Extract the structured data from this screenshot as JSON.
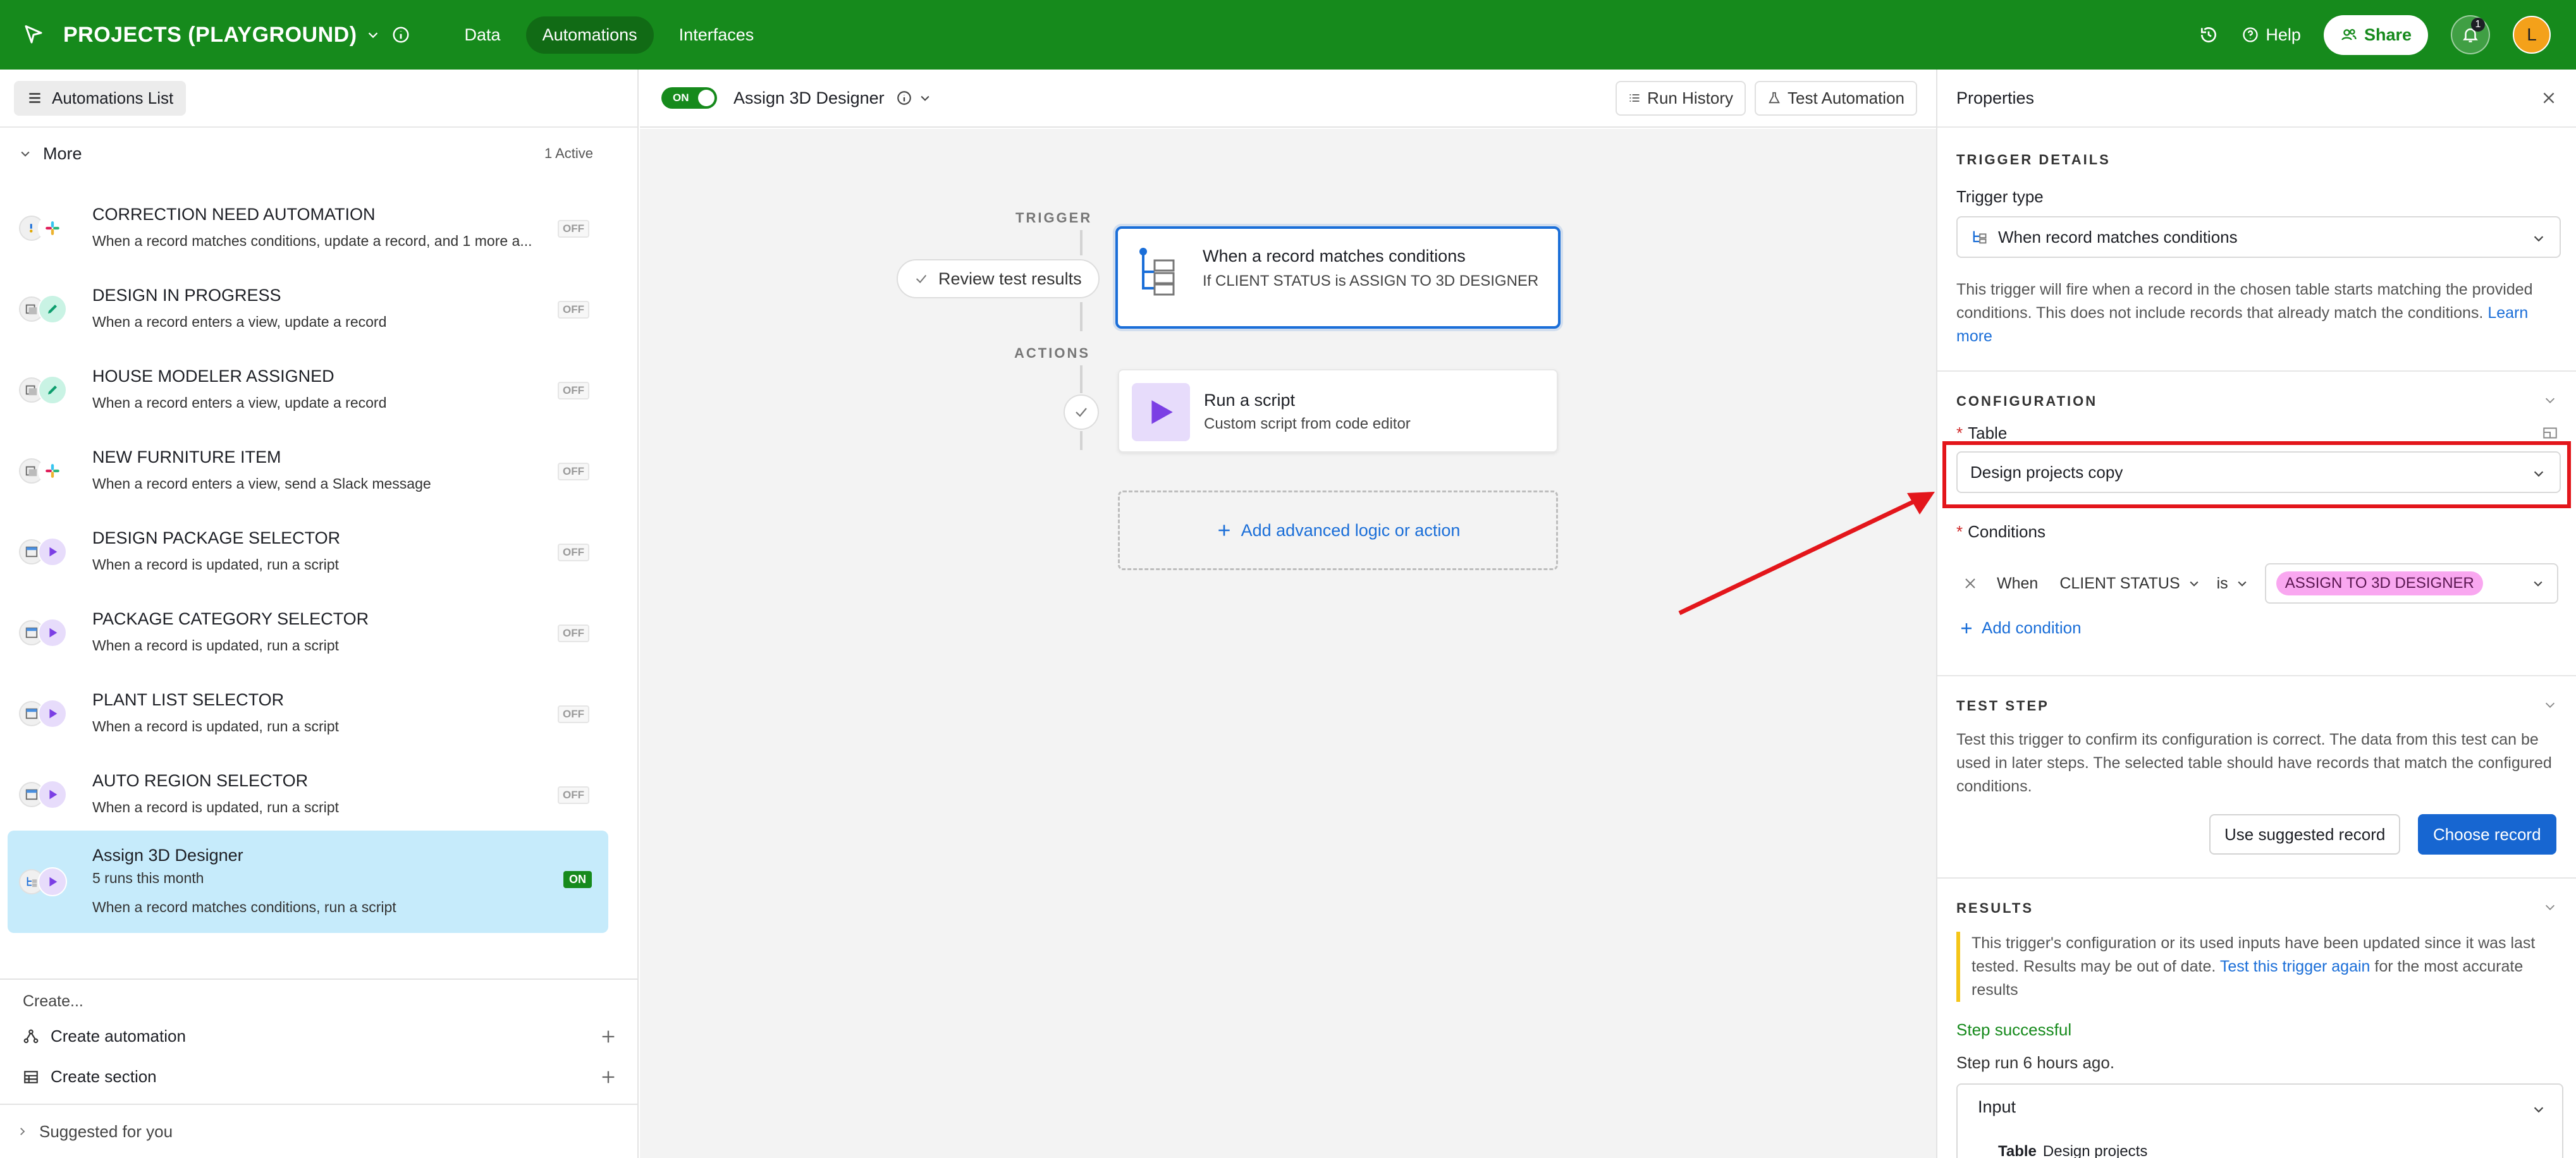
{
  "topbar": {
    "base_name": "PROJECTS (PLAYGROUND)",
    "tabs": [
      "Data",
      "Automations",
      "Interfaces"
    ],
    "help_label": "Help",
    "share_label": "Share",
    "notification_count": "1",
    "avatar_initial": "L",
    "colors": {
      "bar": "#168a1c"
    }
  },
  "sidebar": {
    "list_button": "Automations List",
    "section_name": "More",
    "section_status": "1 Active",
    "items": [
      {
        "title": "CORRECTION NEED AUTOMATION",
        "desc": "When a record matches conditions, update a record, and 1 more a...",
        "state": "OFF",
        "icons": [
          "record-icon",
          "slack-icon"
        ]
      },
      {
        "title": "DESIGN IN PROGRESS",
        "desc": "When a record enters a view, update a record",
        "state": "OFF",
        "icons": [
          "view-icon",
          "pencil-icon"
        ]
      },
      {
        "title": "HOUSE MODELER ASSIGNED",
        "desc": "When a record enters a view, update a record",
        "state": "OFF",
        "icons": [
          "view-icon",
          "pencil-icon"
        ]
      },
      {
        "title": "NEW FURNITURE ITEM",
        "desc": "When a record enters a view, send a Slack message",
        "state": "OFF",
        "icons": [
          "view-icon",
          "slack-icon"
        ]
      },
      {
        "title": "DESIGN PACKAGE SELECTOR",
        "desc": "When a record is updated, run a script",
        "state": "OFF",
        "icons": [
          "record-updated-icon",
          "script-icon"
        ]
      },
      {
        "title": "PACKAGE CATEGORY SELECTOR",
        "desc": "When a record is updated, run a script",
        "state": "OFF",
        "icons": [
          "record-updated-icon",
          "script-icon"
        ]
      },
      {
        "title": "PLANT LIST SELECTOR",
        "desc": "When a record is updated, run a script",
        "state": "OFF",
        "icons": [
          "record-updated-icon",
          "script-icon"
        ]
      },
      {
        "title": "AUTO REGION SELECTOR",
        "desc": "When a record is updated, run a script",
        "state": "OFF",
        "icons": [
          "record-updated-icon",
          "script-icon"
        ]
      },
      {
        "title": "Assign 3D Designer",
        "runs": "5 runs this month",
        "desc": "When a record matches conditions, run a script",
        "state": "ON",
        "icons": [
          "conditions-icon",
          "script-icon"
        ]
      }
    ],
    "create_label": "Create...",
    "create_automation": "Create automation",
    "create_section": "Create section",
    "suggested": "Suggested for you"
  },
  "canvas": {
    "toggle_label": "ON",
    "automation_name": "Assign 3D Designer",
    "run_history": "Run History",
    "test_automation": "Test Automation",
    "trigger_label": "TRIGGER",
    "actions_label": "ACTIONS",
    "review_results": "Review test results",
    "trigger_card": {
      "title": "When a record matches conditions",
      "sub": "If CLIENT STATUS is ASSIGN TO 3D DESIGNER"
    },
    "action_card": {
      "title": "Run a script",
      "sub": "Custom script from code editor"
    },
    "add_logic": "Add advanced logic or action"
  },
  "properties": {
    "title": "Properties",
    "trigger_details": "TRIGGER DETAILS",
    "trigger_type_label": "Trigger type",
    "trigger_type_value": "When record matches conditions",
    "trigger_help": "This trigger will fire when a record in the chosen table starts matching the provided conditions. This does not include records that already match the conditions.",
    "learn_more": "Learn more",
    "configuration": "CONFIGURATION",
    "table_label": "Table",
    "table_value": "Design projects copy",
    "conditions_label": "Conditions",
    "cond_when": "When",
    "cond_field": "CLIENT STATUS",
    "cond_op": "is",
    "cond_value": "ASSIGN TO 3D DESIGNER",
    "add_condition": "Add condition",
    "test_step": "TEST STEP",
    "test_help": "Test this trigger to confirm its configuration is correct. The data from this test can be used in later steps. The selected table should have records that match the configured conditions.",
    "use_suggested": "Use suggested record",
    "choose_record": "Choose record",
    "results": "RESULTS",
    "results_warn_pre": "This trigger's configuration or its used inputs have been updated since it was last tested. Results may be out of date.",
    "results_warn_link": "Test this trigger again",
    "results_warn_post": "for the most accurate results",
    "step_success": "Step successful",
    "step_run": "Step run 6 hours ago.",
    "input_title": "Input",
    "input_table_key": "Table",
    "input_table_value": "Design projects"
  }
}
